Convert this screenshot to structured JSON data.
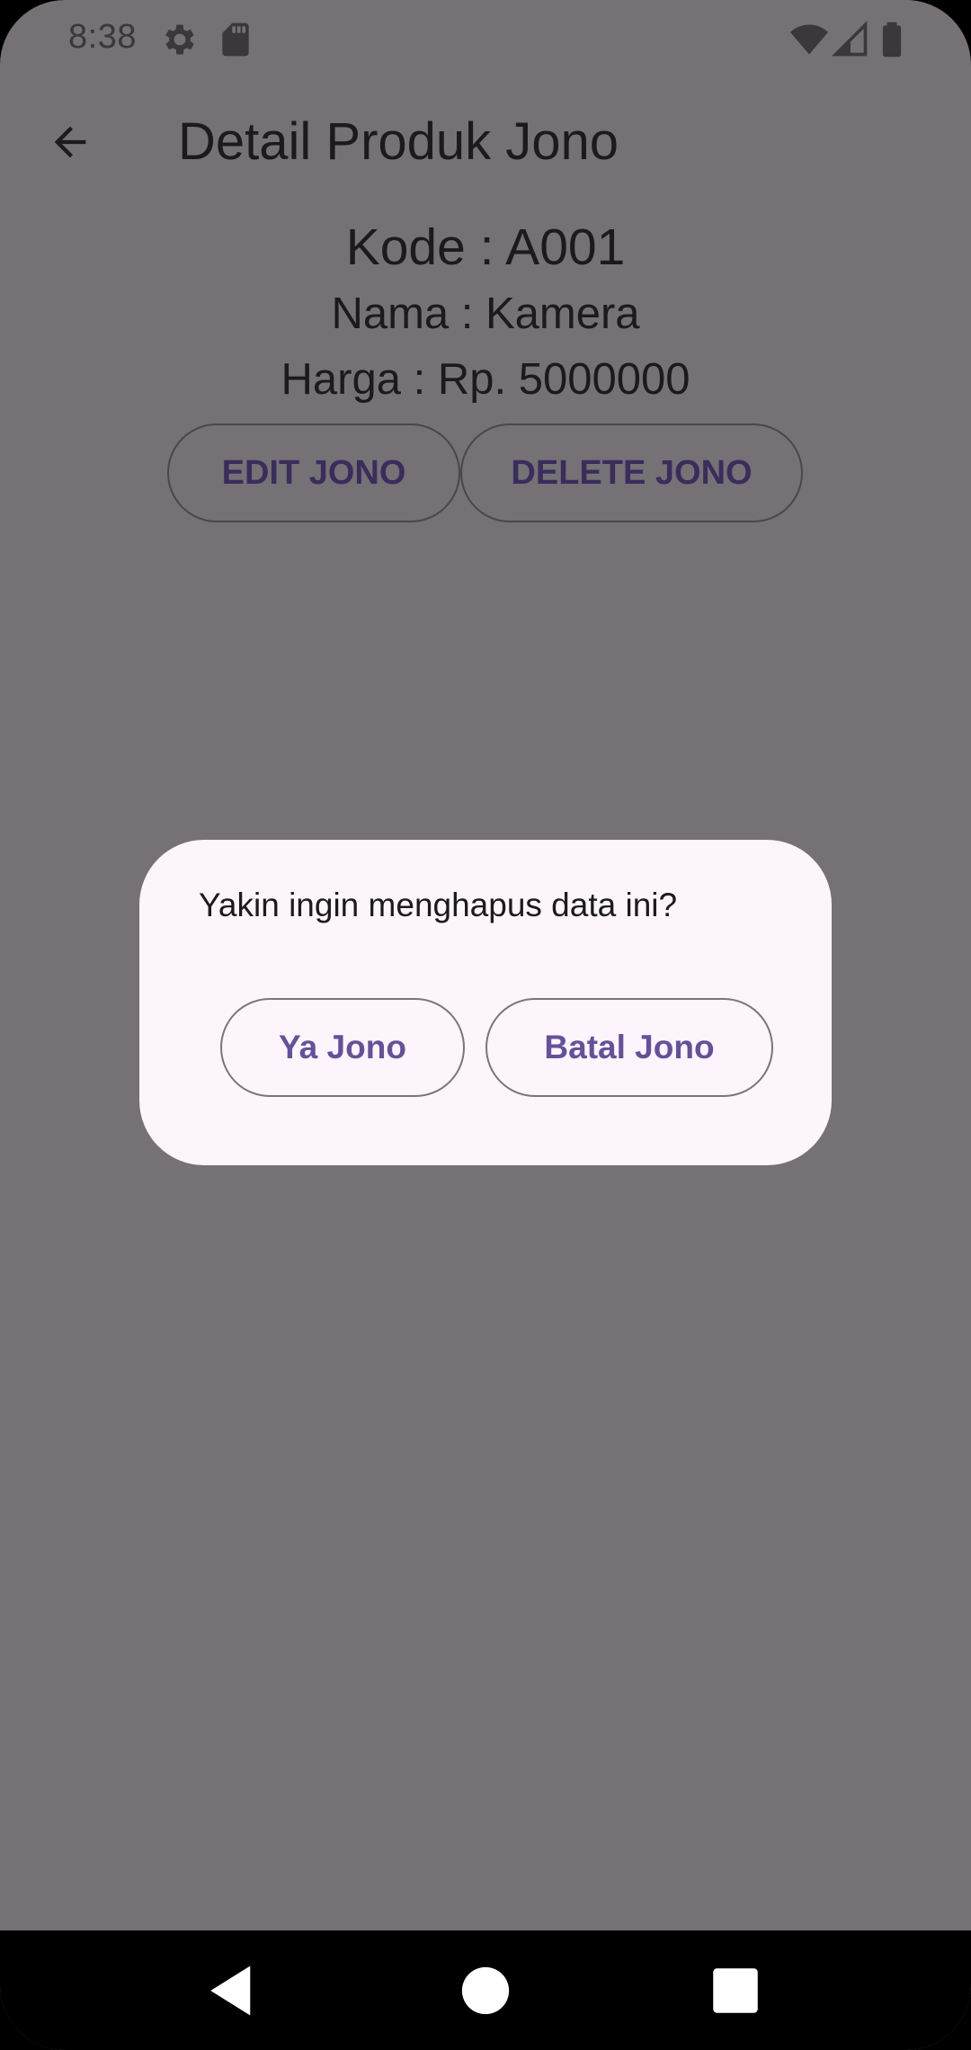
{
  "status_bar": {
    "time": "8:38",
    "icons": [
      "settings-gear-icon",
      "sd-card-icon",
      "wifi-icon",
      "cell-signal-icon",
      "battery-icon"
    ]
  },
  "app_bar": {
    "title": "Detail Produk Jono",
    "back_icon": "arrow-left-icon"
  },
  "product": {
    "kode": "Kode : A001",
    "nama": "Nama : Kamera",
    "harga": "Harga : Rp. 5000000"
  },
  "actions": {
    "edit_label": "EDIT JONO",
    "delete_label": "DELETE JONO"
  },
  "dialog": {
    "message": "Yakin ingin menghapus data ini?",
    "confirm_label": "Ya Jono",
    "cancel_label": "Batal Jono"
  },
  "nav_bar": {
    "icons": [
      "back-triangle-icon",
      "home-circle-icon",
      "recents-square-icon"
    ]
  },
  "colors": {
    "scrim": "#757175",
    "dialog_bg": "#fcf5fb",
    "dialog_button_text": "#64519a",
    "page_button_text": "#3a2d5c"
  }
}
